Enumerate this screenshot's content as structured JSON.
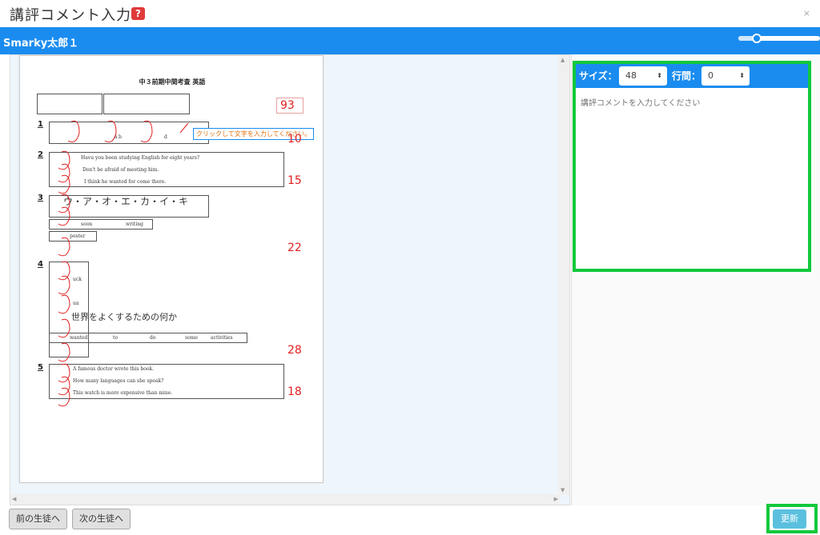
{
  "window": {
    "title": "講評コメント入力",
    "help_label": "?",
    "close_label": "×"
  },
  "header": {
    "student_name": "Smarky太郎１"
  },
  "paper": {
    "title": "中３前期中間考査  英語",
    "tooltip": "クリックして文字を入力してください。",
    "sections": [
      {
        "num": "1",
        "score": "10"
      },
      {
        "num": "2",
        "score": "15"
      },
      {
        "num": "3",
        "score": "22"
      },
      {
        "num": "4",
        "score": "28"
      },
      {
        "num": "5",
        "score": "18"
      }
    ],
    "total_score": "93",
    "answers": {
      "s1_a": "a",
      "s1_b": "b",
      "s1_d": "d",
      "s2_1": "Havu you been studying English for eight years?",
      "s2_2": "Don't be afraid of meeting him.",
      "s2_3": "I think he wanted for come there.",
      "s3_seq": "ウ・ア・オ・エ・カ・イ・キ",
      "s3_soon": "soon",
      "s3_writing": "writing",
      "s3_poster": "poster",
      "s4_luck": "uck",
      "s4_un": "un",
      "s4_hand": "世界をよくするための何か",
      "s4_w1": "wanted",
      "s4_w2": "to",
      "s4_w3": "do",
      "s4_w4": "some",
      "s4_w5": "activities",
      "s5_1": "A famous doctor wrote this book.",
      "s5_2": "How many languages can she speak?",
      "s5_3": "This watch is more expensive than mine."
    }
  },
  "editor": {
    "size_label": "サイズ：",
    "size_value": "48",
    "spacing_label": "行間：",
    "spacing_value": "0",
    "placeholder": "講評コメントを入力してください"
  },
  "footer": {
    "prev_label": "前の生徒へ",
    "next_label": "次の生徒へ",
    "update_label": "更新"
  },
  "colors": {
    "accent": "#1a8cf0",
    "highlight": "#11c93c",
    "mark_red": "#e02020"
  }
}
